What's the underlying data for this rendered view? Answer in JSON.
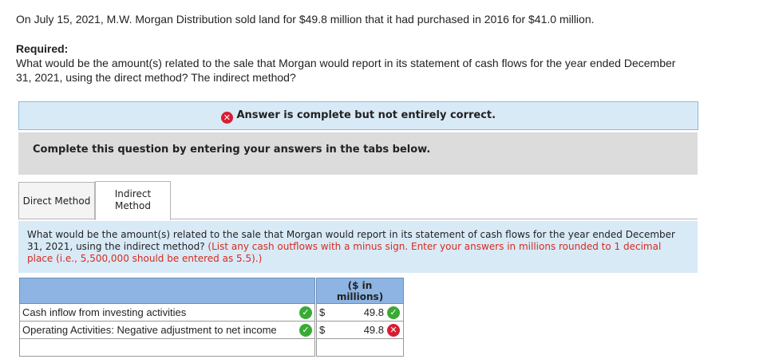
{
  "intro": "On July 15, 2021, M.W. Morgan Distribution sold land for $49.8 million that it had purchased in 2016 for $41.0 million.",
  "required_label": "Required:",
  "required_line1": "What would be the amount(s) related to the sale that Morgan would report in its statement of cash flows for the year ended December",
  "required_line2": "31, 2021, using the direct method? The indirect method?",
  "answer_banner": "Answer is complete but not entirely correct.",
  "complete_instruction": "Complete this question by entering your answers in the tabs below.",
  "tabs": {
    "direct": "Direct Method",
    "indirect_line1": "Indirect",
    "indirect_line2": "Method"
  },
  "question": {
    "text": "What would be the amount(s) related to the sale that Morgan would report in its statement of cash flows for the year ended December 31, 2021, using the indirect method?",
    "instruction": "(List any cash outflows with a minus sign. Enter your answers in millions rounded to 1 decimal place (i.e., 5,500,000 should be entered as 5.5).)"
  },
  "table": {
    "header_line1": "($ in",
    "header_line2": "millions)",
    "rows": [
      {
        "label": "Cash inflow from investing activities",
        "currency": "$",
        "value": "49.8",
        "label_status": "correct",
        "value_status": "correct"
      },
      {
        "label": "Operating Activities: Negative adjustment to net income",
        "currency": "$",
        "value": "49.8",
        "label_status": "correct",
        "value_status": "incorrect"
      }
    ]
  },
  "colors": {
    "banner_bg": "#d9eaf7",
    "table_header": "#8db4e2",
    "correct": "#3aaa35",
    "incorrect": "#d81d33",
    "instruction_red": "#d52b1e"
  },
  "icons": {
    "x": "✕",
    "check": "✓"
  }
}
